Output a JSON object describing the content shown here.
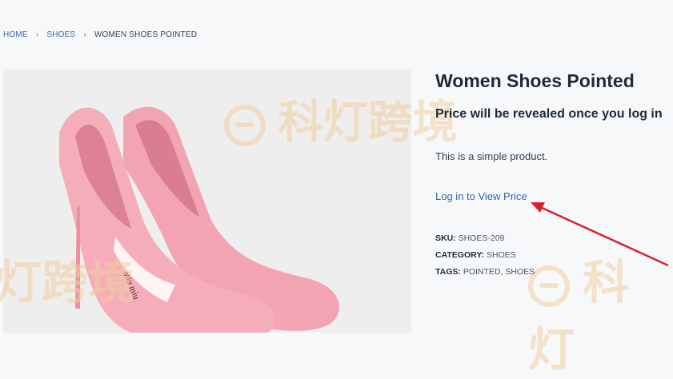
{
  "breadcrumb": {
    "home": "HOME",
    "category": "SHOES",
    "current": "WOMEN SHOES POINTED",
    "separator": "›"
  },
  "product": {
    "title": "Women Shoes Pointed",
    "price_note": "Price will be revealed once you log in",
    "short_description": "This is a simple product.",
    "login_link": "Log in to View Price",
    "image_brand_text": "miu miu",
    "sku_label": "SKU:",
    "sku": "SHOES-209",
    "category_label": "CATEGORY:",
    "category": "SHOES",
    "tags_label": "TAGS:",
    "tags": [
      "POINTED",
      "SHOES"
    ],
    "tag_separator": ","
  },
  "watermark": {
    "text_top": "科灯跨境",
    "text_bottom_left": "灯跨境",
    "text_bottom_right": "科灯"
  },
  "colors": {
    "link": "#2f66b3",
    "annotation_arrow": "#d9232a",
    "shoe_pink": "#ef9aa8"
  }
}
